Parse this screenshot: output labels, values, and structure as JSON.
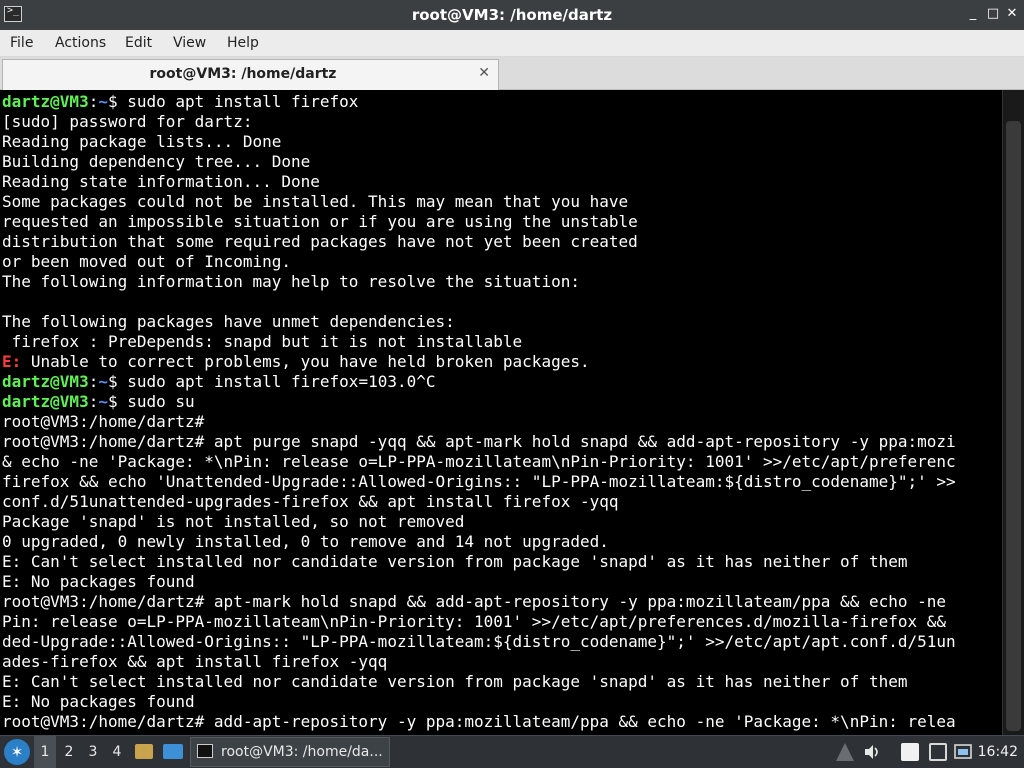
{
  "window": {
    "title": "root@VM3: /home/dartz",
    "title_icon": "terminal-icon",
    "controls": {
      "minimize": "_",
      "maximize": "□",
      "close": "✕"
    }
  },
  "menubar": {
    "items": [
      "File",
      "Actions",
      "Edit",
      "View",
      "Help"
    ]
  },
  "tabs": [
    {
      "label": "root@VM3: /home/dartz",
      "close": "✕"
    }
  ],
  "terminal": {
    "colors": {
      "background": "#000000",
      "text": "#ffffff",
      "prompt_user": "#5ef054",
      "prompt_path": "#5b8ef0",
      "error": "#ff3b3b"
    },
    "lines": [
      {
        "type": "prompt",
        "user": "dartz@VM3",
        "sep": ":",
        "path": "~",
        "sign": "$ ",
        "cmd": "sudo apt install firefox"
      },
      {
        "type": "text",
        "text": "[sudo] password for dartz:"
      },
      {
        "type": "text",
        "text": "Reading package lists... Done"
      },
      {
        "type": "text",
        "text": "Building dependency tree... Done"
      },
      {
        "type": "text",
        "text": "Reading state information... Done"
      },
      {
        "type": "text",
        "text": "Some packages could not be installed. This may mean that you have"
      },
      {
        "type": "text",
        "text": "requested an impossible situation or if you are using the unstable"
      },
      {
        "type": "text",
        "text": "distribution that some required packages have not yet been created"
      },
      {
        "type": "text",
        "text": "or been moved out of Incoming."
      },
      {
        "type": "text",
        "text": "The following information may help to resolve the situation:"
      },
      {
        "type": "text",
        "text": ""
      },
      {
        "type": "text",
        "text": "The following packages have unmet dependencies:"
      },
      {
        "type": "text",
        "text": " firefox : PreDepends: snapd but it is not installable"
      },
      {
        "type": "error",
        "tag": "E:",
        "text": " Unable to correct problems, you have held broken packages."
      },
      {
        "type": "prompt",
        "user": "dartz@VM3",
        "sep": ":",
        "path": "~",
        "sign": "$ ",
        "cmd": "sudo apt install firefox=103.0^C"
      },
      {
        "type": "prompt",
        "user": "dartz@VM3",
        "sep": ":",
        "path": "~",
        "sign": "$ ",
        "cmd": "sudo su"
      },
      {
        "type": "text",
        "text": "root@VM3:/home/dartz#"
      },
      {
        "type": "text",
        "text": "root@VM3:/home/dartz# apt purge snapd -yqq && apt-mark hold snapd && add-apt-repository -y ppa:mozi"
      },
      {
        "type": "text",
        "text": "& echo -ne 'Package: *\\nPin: release o=LP-PPA-mozillateam\\nPin-Priority: 1001' >>/etc/apt/preferenc"
      },
      {
        "type": "text",
        "text": "firefox && echo 'Unattended-Upgrade::Allowed-Origins:: \"LP-PPA-mozillateam:${distro_codename}\";' >>"
      },
      {
        "type": "text",
        "text": "conf.d/51unattended-upgrades-firefox && apt install firefox -yqq"
      },
      {
        "type": "text",
        "text": "Package 'snapd' is not installed, so not removed"
      },
      {
        "type": "text",
        "text": "0 upgraded, 0 newly installed, 0 to remove and 14 not upgraded."
      },
      {
        "type": "text",
        "text": "E: Can't select installed nor candidate version from package 'snapd' as it has neither of them"
      },
      {
        "type": "text",
        "text": "E: No packages found"
      },
      {
        "type": "text",
        "text": "root@VM3:/home/dartz# apt-mark hold snapd && add-apt-repository -y ppa:mozillateam/ppa && echo -ne"
      },
      {
        "type": "text",
        "text": "Pin: release o=LP-PPA-mozillateam\\nPin-Priority: 1001' >>/etc/apt/preferences.d/mozilla-firefox &&"
      },
      {
        "type": "text",
        "text": "ded-Upgrade::Allowed-Origins:: \"LP-PPA-mozillateam:${distro_codename}\";' >>/etc/apt/apt.conf.d/51un"
      },
      {
        "type": "text",
        "text": "ades-firefox && apt install firefox -yqq"
      },
      {
        "type": "text",
        "text": "E: Can't select installed nor candidate version from package 'snapd' as it has neither of them"
      },
      {
        "type": "text",
        "text": "E: No packages found"
      },
      {
        "type": "text",
        "text": "root@VM3:/home/dartz# add-apt-repository -y ppa:mozillateam/ppa && echo -ne 'Package: *\\nPin: relea"
      }
    ]
  },
  "taskbar": {
    "start_icon": "lubuntu-logo-icon",
    "workspaces": [
      "1",
      "2",
      "3",
      "4"
    ],
    "active_workspace": "1",
    "task_label": "root@VM3: /home/da...",
    "clock": "16:42"
  }
}
